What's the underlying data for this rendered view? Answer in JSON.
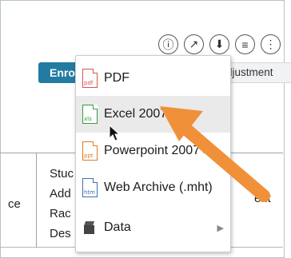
{
  "toolbar": {
    "info_icon": "ⓘ",
    "open_icon": "↗",
    "download_icon": "⬇",
    "filter_icon": "≡",
    "more_icon": "⋮"
  },
  "tabs": {
    "enroll_label": "Enro",
    "adjustment_label": "djustment"
  },
  "grid": {
    "left_cell": "ce",
    "mid_lines": [
      "Stuc",
      "Add",
      "Rac",
      "Des"
    ],
    "right_cell": "ent"
  },
  "export_menu": {
    "items": [
      {
        "label": "PDF",
        "icon": "pdf-file-icon",
        "tag": "pdf",
        "color": "#d9534f"
      },
      {
        "label": "Excel 2007+",
        "icon": "xls-file-icon",
        "tag": "xls",
        "color": "#3b9a3b"
      },
      {
        "label": "Powerpoint 2007+",
        "icon": "ppt-file-icon",
        "tag": "ppt",
        "color": "#e07b24"
      },
      {
        "label": "Web Archive (.mht)",
        "icon": "mht-file-icon",
        "tag": "htm",
        "color": "#3c6fb4"
      },
      {
        "label": "Data",
        "icon": "data-cube-icon"
      }
    ],
    "highlighted_index": 1,
    "submenu_arrow": "▶"
  },
  "annotation": {
    "arrow_color": "#f0913a"
  },
  "colors": {
    "enroll_bg": "#237ba1",
    "menu_highlight": "#eaeaea"
  }
}
